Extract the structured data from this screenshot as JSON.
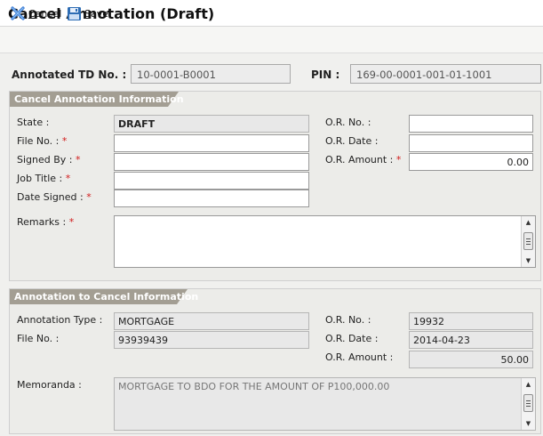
{
  "title": "Cancel Annotation (Draft)",
  "toolbar": {
    "cancel_label": "ancel",
    "cancel_mnemonic": "C",
    "save_label": "ave",
    "save_mnemonic": "S"
  },
  "header": {
    "td_label": "Annotated TD No. :",
    "td_value": "10-0001-B0001",
    "pin_label": "PIN :",
    "pin_value": "169-00-0001-001-01-1001"
  },
  "cancel_info": {
    "title": "Cancel Annotation Information",
    "state_label": "State :",
    "state_value": "DRAFT",
    "file_no_label": "File No. :",
    "file_no_value": "",
    "signed_by_label": "Signed By :",
    "signed_by_value": "",
    "job_title_label": "Job Title :",
    "job_title_value": "",
    "date_signed_label": "Date Signed :",
    "date_signed_value": "",
    "remarks_label": "Remarks :",
    "remarks_value": "",
    "or_no_label": "O.R. No. :",
    "or_no_value": "",
    "or_date_label": "O.R. Date :",
    "or_date_value": "",
    "or_amount_label": "O.R. Amount :",
    "or_amount_value": "0.00",
    "required_mark": "*"
  },
  "annotation_info": {
    "title": "Annotation to Cancel Information",
    "type_label": "Annotation Type :",
    "type_value": "MORTGAGE",
    "file_no_label": "File No. :",
    "file_no_value": "93939439",
    "or_no_label": "O.R. No. :",
    "or_no_value": "19932",
    "or_date_label": "O.R. Date :",
    "or_date_value": "2014-04-23",
    "or_amount_label": "O.R. Amount :",
    "or_amount_value": "50.00",
    "memoranda_label": "Memoranda :",
    "memoranda_value": "MORTGAGE TO BDO FOR THE AMOUNT OF P100,000.00"
  },
  "colors": {
    "panel_header": "#a39e93",
    "required": "#d21a1a",
    "cancel_icon": "#3a7bd5",
    "save_icon": "#2e6db4"
  },
  "icons": {
    "cancel": "x-cancel-icon",
    "save": "floppy-disk-icon"
  }
}
